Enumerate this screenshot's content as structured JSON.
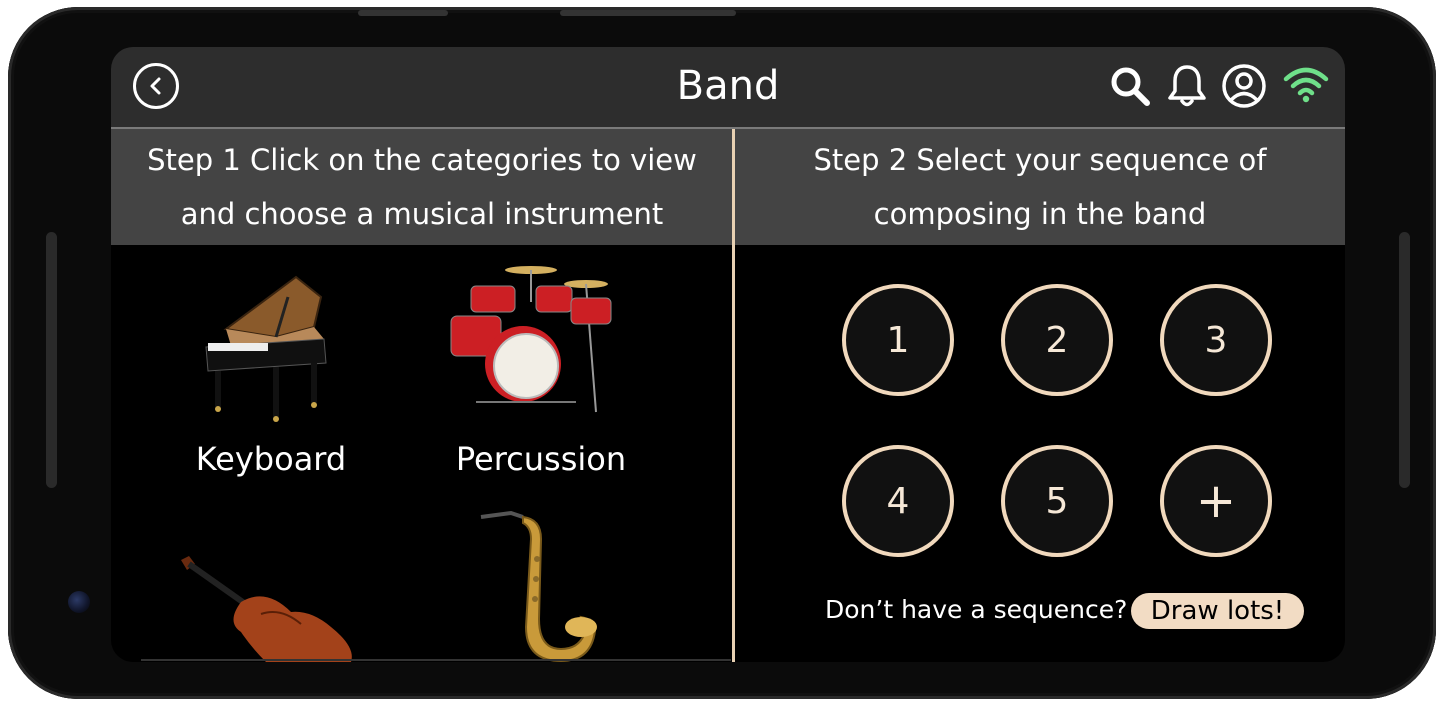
{
  "header": {
    "title": "Band",
    "icons": [
      "back-icon",
      "search-icon",
      "bell-icon",
      "user-icon",
      "wifi-icon"
    ]
  },
  "steps": {
    "step1": {
      "line1": "Step 1  Click on the categories to view",
      "line2": "and choose a musical instrument"
    },
    "step2": {
      "line1": "Step 2  Select your sequence of",
      "line2": "composing in the band"
    }
  },
  "instruments": [
    {
      "label": "Keyboard"
    },
    {
      "label": "Percussion"
    },
    {
      "label": ""
    },
    {
      "label": ""
    }
  ],
  "sequence": {
    "slots": [
      "1",
      "2",
      "3",
      "4",
      "5"
    ],
    "add_label": "+"
  },
  "footer": {
    "prompt": "Don’t have a sequence?",
    "draw_button": "Draw lots!"
  },
  "colors": {
    "accent": "#f1d9bd",
    "wifi": "#6fe08a",
    "header_bg": "#2d2d2d",
    "step_bg": "#444444"
  }
}
